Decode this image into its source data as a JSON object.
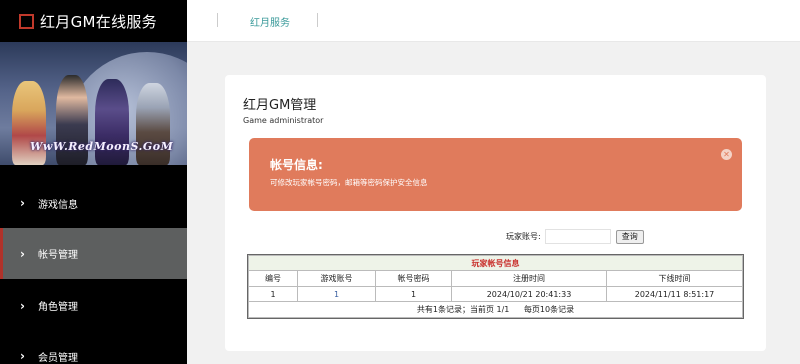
{
  "sidebar": {
    "brand_title": "红月GM在线服务",
    "banner_text": "WwW.RedMoonS.GoM",
    "items": [
      {
        "label": "游戏信息",
        "active": false
      },
      {
        "label": "帐号管理",
        "active": true
      },
      {
        "label": "角色管理",
        "active": false
      },
      {
        "label": "会员管理",
        "active": false
      }
    ]
  },
  "topbar": {
    "tab_label": "红月服务"
  },
  "card": {
    "title": "红月GM管理",
    "subtitle": "Game administrator"
  },
  "alert": {
    "title": "帐号信息:",
    "description": "可修改玩家帐号密码，邮箱等密码保护安全信息",
    "close_icon": "close-icon",
    "color": "#e07b5c"
  },
  "search": {
    "label": "玩家账号:",
    "value": "",
    "button_label": "查询"
  },
  "table": {
    "caption": "玩家帐号信息",
    "headers": [
      "编号",
      "游戏账号",
      "帐号密码",
      "注册时间",
      "下线时间"
    ],
    "rows": [
      [
        "1",
        "1",
        "1",
        "2024/10/21 20:41:33",
        "2024/11/11 8:51:17"
      ]
    ],
    "footer_summary": "共有1条记录；当前页 1/1",
    "footer_per_page": "每页10条记录"
  },
  "colors": {
    "sidebar_bg": "#000000",
    "active_item_bg": "#5d5f5f",
    "accent_red": "#b0322a",
    "tab_teal": "#3a9a9a",
    "caption_red": "#c9302c"
  }
}
